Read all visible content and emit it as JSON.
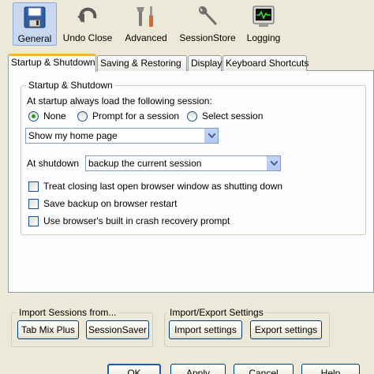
{
  "toolbar": {
    "items": [
      {
        "label": "General",
        "icon": "floppy-disk-icon",
        "active": true
      },
      {
        "label": "Undo Close",
        "icon": "undo-arrow-icon"
      },
      {
        "label": "Advanced",
        "icon": "tools-icon"
      },
      {
        "label": "SessionStore",
        "icon": "wrench-icon"
      },
      {
        "label": "Logging",
        "icon": "monitor-icon"
      }
    ]
  },
  "tabs": [
    {
      "label": "Startup & Shutdown",
      "active": true
    },
    {
      "label": "Saving & Restoring"
    },
    {
      "label": "Display"
    },
    {
      "label": "Keyboard Shortcuts"
    }
  ],
  "startup_group": {
    "legend": "Startup & Shutdown",
    "startup_label": "At startup always load the following session:",
    "radios": [
      {
        "label": "None",
        "checked": true
      },
      {
        "label": "Prompt for a session",
        "checked": false
      },
      {
        "label": "Select session",
        "checked": false
      }
    ],
    "startup_select_value": "Show my home page",
    "shutdown_label": "At shutdown",
    "shutdown_select_value": "backup the current session",
    "checkboxes": [
      {
        "label": "Treat closing last open browser window as shutting down",
        "checked": false
      },
      {
        "label": "Save backup on browser restart",
        "checked": false
      },
      {
        "label": "Use browser's built in crash recovery prompt",
        "checked": false
      }
    ]
  },
  "import_sessions": {
    "legend": "Import Sessions from...",
    "buttons": [
      "Tab Mix Plus",
      "SessionSaver"
    ]
  },
  "import_export": {
    "legend": "Import/Export Settings",
    "buttons": [
      "Import settings",
      "Export settings"
    ]
  },
  "dialog_buttons": [
    "OK",
    "Apply",
    "Cancel",
    "Help"
  ],
  "colors": {
    "accent_tab": "#f3b33d",
    "active_toolbar": "#c8d9ef",
    "window_bg": "#ece9d8"
  }
}
